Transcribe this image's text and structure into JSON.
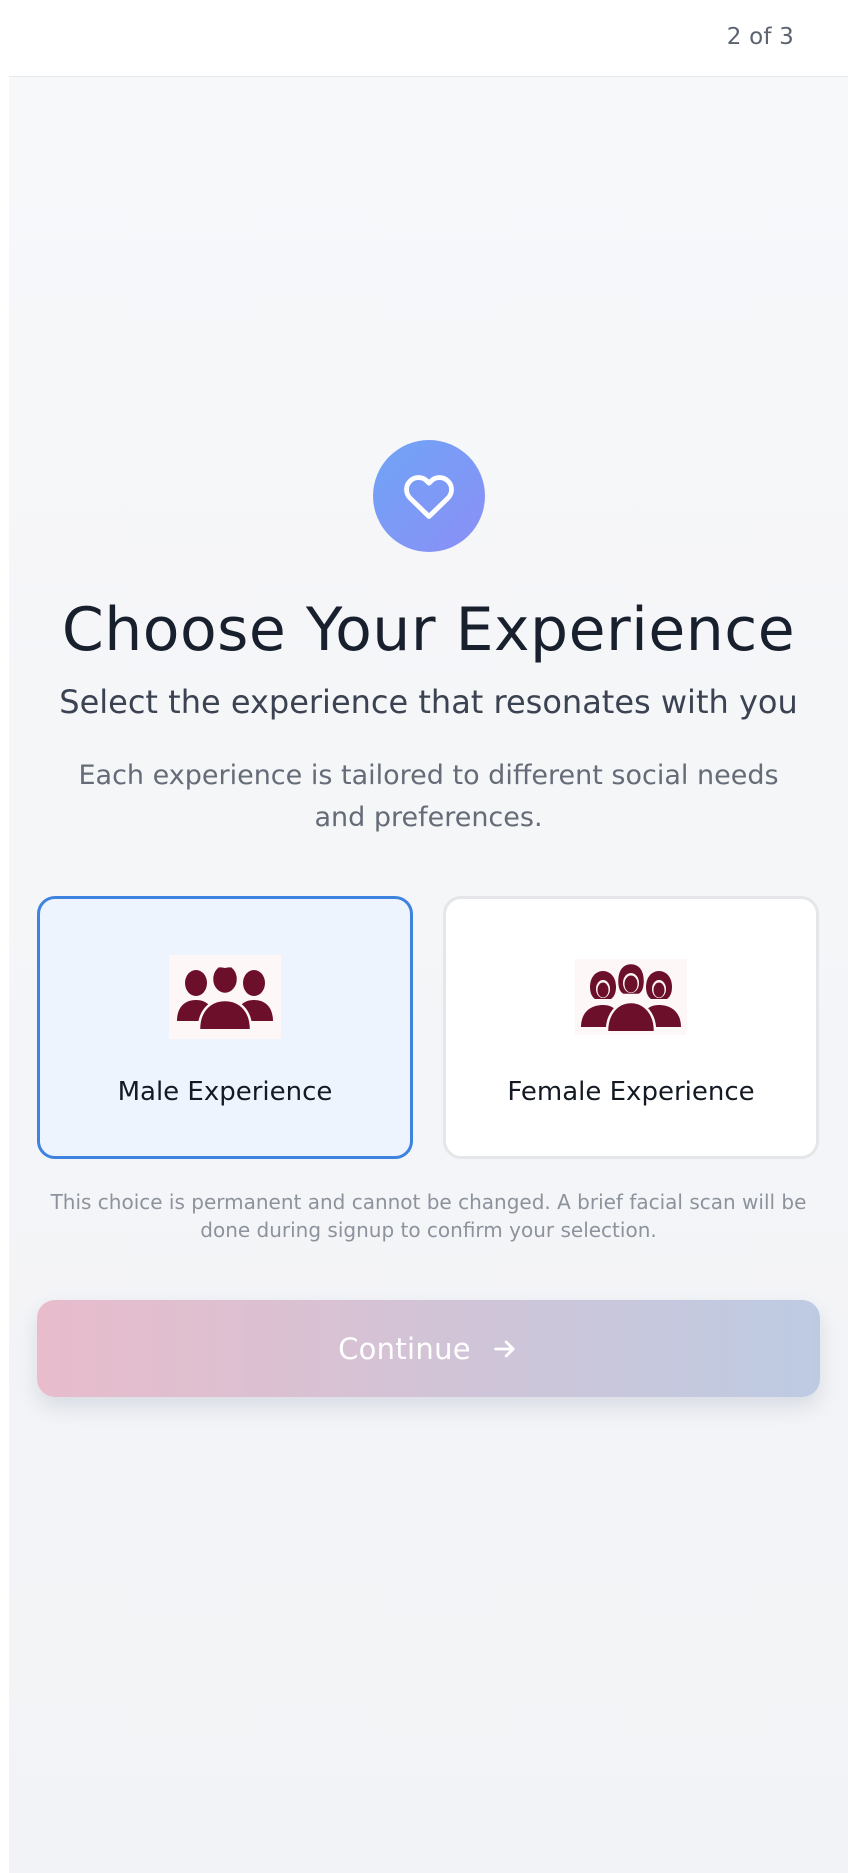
{
  "header": {
    "step": "2 of 3"
  },
  "hero": {
    "icon": "heart-icon",
    "title": "Choose Your Experience",
    "subtitle": "Select the experience that resonates with you",
    "description": "Each experience is tailored to different social needs and preferences."
  },
  "options": [
    {
      "label": "Male Experience",
      "icon": "male-group-icon",
      "selected": true
    },
    {
      "label": "Female Experience",
      "icon": "female-group-icon",
      "selected": false
    }
  ],
  "disclaimer": "This choice is permanent and cannot be changed. A brief facial scan will be done during signup to confirm your selection.",
  "continue": {
    "label": "Continue",
    "icon": "arrow-right-icon"
  },
  "colors": {
    "accent_blue": "#3f83e0",
    "icon_maroon": "#6b0f2b",
    "heart_gradient": [
      "#6fa4f6",
      "#8b8ff6"
    ],
    "button_gradient": [
      "#e8bccb",
      "#bdcbe2"
    ]
  }
}
